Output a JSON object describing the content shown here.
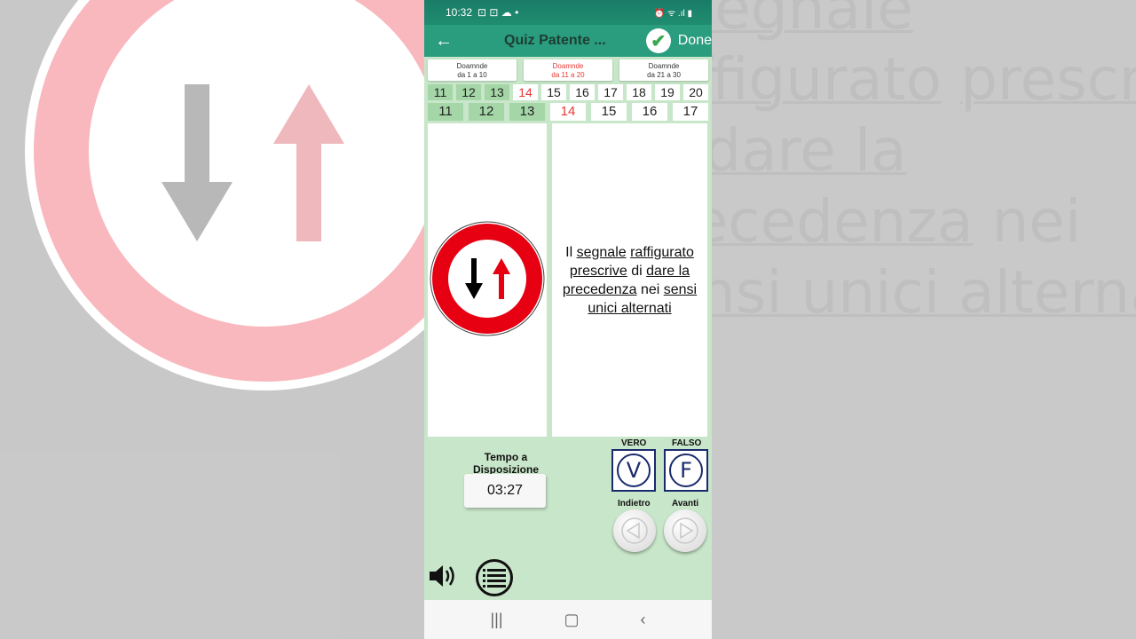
{
  "background": {
    "right_text_lines": [
      {
        "parts": [
          {
            "t": "Il ",
            "u": false
          },
          {
            "t": "segnale",
            "u": true
          }
        ]
      },
      {
        "parts": [
          {
            "t": "raffigurato",
            "u": true
          },
          {
            "t": " ",
            "u": false
          },
          {
            "t": "prescrive",
            "u": true
          }
        ]
      },
      {
        "parts": [
          {
            "t": "di ",
            "u": false
          },
          {
            "t": "dare la",
            "u": true
          }
        ]
      },
      {
        "parts": [
          {
            "t": "precedenza",
            "u": true
          },
          {
            "t": " nei",
            "u": false
          }
        ]
      },
      {
        "parts": [
          {
            "t": "sensi unici alternati",
            "u": true
          }
        ]
      }
    ]
  },
  "status": {
    "time": "10:32",
    "icons": "⊡ ⊡ ☁ •",
    "right_icons": "⏰ ᯤ .ıl ▮"
  },
  "appbar": {
    "back": "←",
    "title": "Quiz Patente ...",
    "done_label": "Done",
    "done_check": "✔"
  },
  "ranges": [
    {
      "line1": "Doamnde",
      "line2": "da 1 a 10",
      "active": false
    },
    {
      "line1": "Doamnde",
      "line2": "da 11 a 20",
      "active": true
    },
    {
      "line1": "Doamnde",
      "line2": "da 21 a 30",
      "active": false
    }
  ],
  "numbers_row1": [
    "11",
    "12",
    "13",
    "14",
    "15",
    "16",
    "17",
    "18",
    "19",
    "20"
  ],
  "numbers_row2": [
    "11",
    "12",
    "13",
    "14",
    "15",
    "16",
    "17"
  ],
  "question": {
    "parts": [
      {
        "t": "Il ",
        "u": false
      },
      {
        "t": "segnale",
        "u": true
      },
      {
        "t": " ",
        "u": false
      },
      {
        "t": "raffigurato",
        "u": true
      },
      {
        "t": " ",
        "u": false
      },
      {
        "t": "prescrive",
        "u": true
      },
      {
        "t": " di ",
        "u": false
      },
      {
        "t": "dare la",
        "u": true
      },
      {
        "t": " ",
        "u": false
      },
      {
        "t": "precedenza",
        "u": true
      },
      {
        "t": " nei ",
        "u": false
      },
      {
        "t": "sensi unici alternati",
        "u": true
      }
    ]
  },
  "timer": {
    "label": "Tempo a Disposizione",
    "value": "03:27"
  },
  "answers": {
    "true_label": "VERO",
    "true_symbol": "V",
    "false_label": "FALSO",
    "false_symbol": "F"
  },
  "navigation": {
    "back_label": "Indietro",
    "next_label": "Avanti"
  },
  "android_nav": {
    "recents": "|||",
    "home": "▢",
    "back": "‹"
  },
  "colors": {
    "accent": "#2a9d7e",
    "answered": "#a5d6a7",
    "current": "#e53935",
    "bg": "#c8e6c9"
  }
}
